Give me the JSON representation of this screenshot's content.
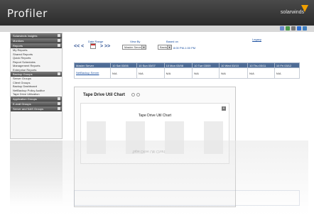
{
  "app": {
    "title": "Profiler",
    "brand": "solarwinds"
  },
  "toolbar": {
    "icon_names": [
      "email-icon",
      "refresh-icon",
      "print-icon",
      "help-icon",
      "globe-icon"
    ]
  },
  "sidebar": {
    "sections": [
      {
        "label": "Solarwinds Insights",
        "items": []
      },
      {
        "label": "Monitors",
        "items": []
      },
      {
        "label": "Reports",
        "items": [
          "My Reports",
          "Shared Reports",
          "Quick Reports",
          "Report Schedules",
          "Management Reports",
          "Enterprise Reports"
        ]
      },
      {
        "label": "Backup Groups",
        "items": [
          "Server Groups",
          "Client Groups",
          "Backup Dashboard",
          "NetBackup Policy Auditor",
          "Tape Drive Utilization"
        ]
      },
      {
        "label": "Application Groups",
        "items": []
      },
      {
        "label": "E-mail Groups",
        "items": []
      },
      {
        "label": "Server and NAS Groups",
        "items": []
      }
    ]
  },
  "controls": {
    "legacy_link": "Legacy",
    "date_range_label": "Date Range",
    "view_by_label": "View By",
    "view_by_value": "Master Server",
    "based_on_label": "Based on",
    "based_on_value": "Backup Window",
    "nav_back": "<< <",
    "nav_forward": "> >>",
    "range_text": "8:00 PM-1:00 PM"
  },
  "table": {
    "headers": [
      "Master Server",
      "10 Sat 03/06",
      "10 Sun 03/07",
      "10 Mon 03/08",
      "10 Tue 03/09",
      "10 Wed 03/10",
      "10 Thu 03/11",
      "10 Fri 03/12"
    ],
    "rows": [
      [
        "NetBackup Server",
        "N/A",
        "N/A",
        "N/A",
        "N/A",
        "N/A",
        "N/A",
        "N/A"
      ]
    ]
  },
  "panel": {
    "title": "Tape Drive Util Chart",
    "chart_title": "Tape Drive Util Chart",
    "expand_label": "+"
  },
  "colors": {
    "header_bg": "#2f2f2f",
    "table_header_bg": "#4e6c96",
    "link": "#1a4fa0",
    "accent": "#f0a000"
  }
}
